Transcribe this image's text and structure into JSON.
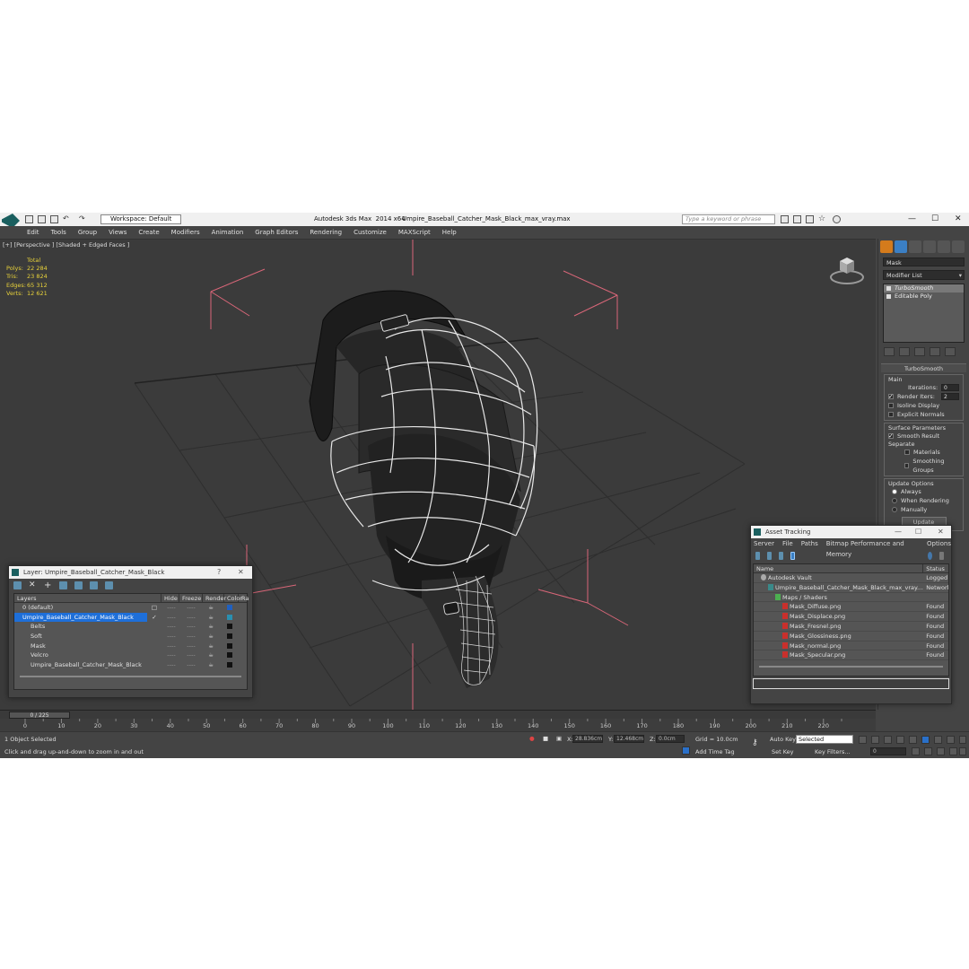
{
  "title_bar": {
    "workspace": "Workspace: Default",
    "app_title": "Autodesk 3ds Max  2014 x64",
    "file_title": "Umpire_Baseball_Catcher_Mask_Black_max_vray.max",
    "search_placeholder": "Type a keyword or phrase"
  },
  "menu": [
    "Edit",
    "Tools",
    "Group",
    "Views",
    "Create",
    "Modifiers",
    "Animation",
    "Graph Editors",
    "Rendering",
    "Customize",
    "MAXScript",
    "Help"
  ],
  "viewport": {
    "label": "[+] [Perspective ] [Shaded + Edged Faces ]",
    "stats_header": "Total",
    "stats": [
      {
        "key": "Polys:",
        "value": "22 284"
      },
      {
        "key": "Tris:",
        "value": "23 824"
      },
      {
        "key": "Edges:",
        "value": "65 312"
      },
      {
        "key": "Verts:",
        "value": "12 621"
      }
    ]
  },
  "command_panel": {
    "object_name": "Mask",
    "modifier_list": "Modifier List",
    "stack": [
      "TurboSmooth",
      "Editable Poly"
    ],
    "rollout_title": "TurboSmooth",
    "main_label": "Main",
    "iterations_label": "Iterations:",
    "iterations_value": "0",
    "render_iters_label": "Render Iters:",
    "render_iters_value": "2",
    "isoline": "Isoline Display",
    "explicit_normals": "Explicit Normals",
    "surface_params": "Surface Parameters",
    "smooth_result": "Smooth Result",
    "separate": "Separate",
    "materials": "Materials",
    "smoothing_groups": "Smoothing Groups",
    "update_options": "Update Options",
    "always": "Always",
    "when_rendering": "When Rendering",
    "manually": "Manually",
    "update_btn": "Update"
  },
  "layer_dialog": {
    "title": "Layer: Umpire_Baseball_Catcher_Mask_Black",
    "help": "?",
    "columns": [
      "Layers",
      "Hide",
      "Freeze",
      "Render",
      "Color",
      "Ra"
    ],
    "rows": [
      {
        "name": "0 (default)",
        "indent": 1,
        "selected": false,
        "color": "#2060c0"
      },
      {
        "name": "Umpire_Baseball_Catcher_Mask_Black",
        "indent": 1,
        "selected": true,
        "color": "#2a8fb0"
      },
      {
        "name": "Belts",
        "indent": 2,
        "selected": false,
        "color": "#111111"
      },
      {
        "name": "Soft",
        "indent": 2,
        "selected": false,
        "color": "#111111"
      },
      {
        "name": "Mask",
        "indent": 2,
        "selected": false,
        "color": "#111111"
      },
      {
        "name": "Velcro",
        "indent": 2,
        "selected": false,
        "color": "#111111"
      },
      {
        "name": "Umpire_Baseball_Catcher_Mask_Black",
        "indent": 2,
        "selected": false,
        "color": "#111111"
      }
    ],
    "dash": "----"
  },
  "asset_dialog": {
    "title": "Asset Tracking",
    "menu": [
      "Server",
      "File",
      "Paths",
      "Bitmap Performance and Memory",
      "Options"
    ],
    "columns": [
      "Name",
      "Status"
    ],
    "rows": [
      {
        "name": "Autodesk Vault",
        "status": "Logged I",
        "indent": 1,
        "type": "vault"
      },
      {
        "name": "Umpire_Baseball_Catcher_Mask_Black_max_vray....",
        "status": "Network",
        "indent": 2,
        "type": "max"
      },
      {
        "name": "Maps / Shaders",
        "status": "",
        "indent": 3,
        "type": "folder"
      },
      {
        "name": "Mask_Diffuse.png",
        "status": "Found",
        "indent": 4,
        "type": "file"
      },
      {
        "name": "Mask_Displace.png",
        "status": "Found",
        "indent": 4,
        "type": "file"
      },
      {
        "name": "Mask_Fresnel.png",
        "status": "Found",
        "indent": 4,
        "type": "file"
      },
      {
        "name": "Mask_Glossiness.png",
        "status": "Found",
        "indent": 4,
        "type": "file"
      },
      {
        "name": "Mask_normal.png",
        "status": "Found",
        "indent": 4,
        "type": "file"
      },
      {
        "name": "Mask_Specular.png",
        "status": "Found",
        "indent": 4,
        "type": "file"
      }
    ]
  },
  "timeline": {
    "slider": "0 / 225",
    "ticks": [
      "0",
      "10",
      "20",
      "30",
      "40",
      "50",
      "60",
      "70",
      "80",
      "90",
      "100",
      "110",
      "120",
      "130",
      "140",
      "150",
      "160",
      "170",
      "180",
      "190",
      "200",
      "210",
      "220"
    ]
  },
  "status": {
    "selected": "1 Object Selected",
    "prompt": "Click and drag up-and-down to zoom in and out",
    "x_label": "X:",
    "x_value": "28.836cm",
    "y_label": "Y:",
    "y_value": "12.468cm",
    "z_label": "Z:",
    "z_value": "0.0cm",
    "grid": "Grid = 10.0cm",
    "add_time_tag": "Add Time Tag",
    "auto_key": "Auto Key",
    "set_key": "Set Key",
    "auto_key_sel": "Selected",
    "key_filters": "Key Filters...",
    "frame": "0"
  },
  "colors": {
    "ui_bg": "#444444",
    "viewport_bg": "#3b3b3b",
    "stats_text": "#e8d23a",
    "selection": "#1e6fd9",
    "bbox": "#e06878"
  }
}
